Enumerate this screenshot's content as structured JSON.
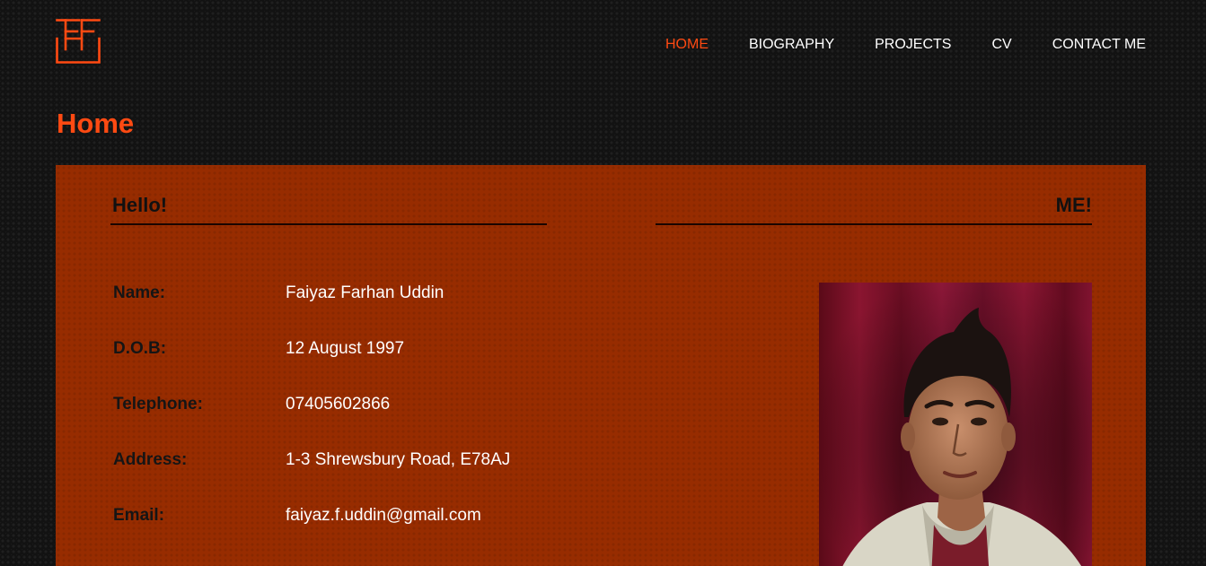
{
  "site": {
    "logo_alt": "FF",
    "brand_color": "#ff4a12"
  },
  "nav": {
    "items": [
      {
        "label": "HOME",
        "active": true
      },
      {
        "label": "BIOGRAPHY",
        "active": false
      },
      {
        "label": "PROJECTS",
        "active": false
      },
      {
        "label": "CV",
        "active": false
      },
      {
        "label": "CONTACT ME",
        "active": false
      }
    ]
  },
  "page": {
    "title": "Home"
  },
  "panel": {
    "left_heading": "Hello!",
    "right_heading": "ME!",
    "background_color": "#972c00",
    "info": [
      {
        "label": "Name:",
        "value": "Faiyaz Farhan Uddin"
      },
      {
        "label": "D.O.B:",
        "value": "12 August 1997"
      },
      {
        "label": "Telephone:",
        "value": "07405602866"
      },
      {
        "label": "Address:",
        "value": "1-3 Shrewsbury Road, E78AJ"
      },
      {
        "label": "Email:",
        "value": "faiyaz.f.uddin@gmail.com"
      }
    ],
    "photo_icon": "portrait-photo"
  }
}
